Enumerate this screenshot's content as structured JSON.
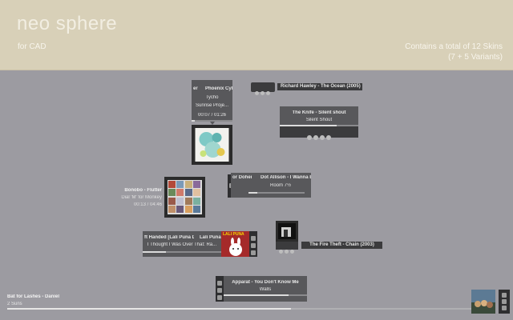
{
  "header": {
    "title": "neo sphere",
    "subtitle": "for CAD",
    "skins_line": "Contains a total of 12 Skins",
    "variants_line": "(7 + 5 Variants)"
  },
  "skin_a": {
    "artist_scroll": "er",
    "track_scroll": "Phoenix Cylo",
    "artist": "Tycho",
    "album": "Sunrise Proje...",
    "time": "00:07 / 01:26"
  },
  "skin_b": {
    "track": "Richard Hawley - The Ocean (2005)"
  },
  "skin_c": {
    "track": "The Knife - Silent shout",
    "album": "Silent Shout"
  },
  "skin_d": {
    "track": "Bonobo - Flutter",
    "album": "Dial 'M' for Monkey",
    "time": "00:13 / 04:46"
  },
  "skin_e": {
    "left_scroll": "or Doherty)",
    "track": "Dot Allison - I Wanna Bre",
    "album": "Room 7½"
  },
  "skin_f": {
    "left_scroll": "ft Handed [Lali Puna Dub]",
    "artist": "Lali Puna -",
    "album": "I Thought I Was Over That: Ra...",
    "cover_text": "LALI PUNA"
  },
  "skin_g": {
    "track": "The Fire Theft - Chain (2003)"
  },
  "skin_h": {
    "track": "Apparat - You Don't Know Me",
    "album": "Walls"
  },
  "skin_i": {
    "track": "Bat for Lashes - Daniel",
    "album": "2 Suns",
    "progress": 0.61
  },
  "progress": {
    "skin_a": 0.08,
    "skin_c": 0.72,
    "skin_e": 0.15,
    "skin_f": 0.3,
    "skin_h": 0.78
  }
}
